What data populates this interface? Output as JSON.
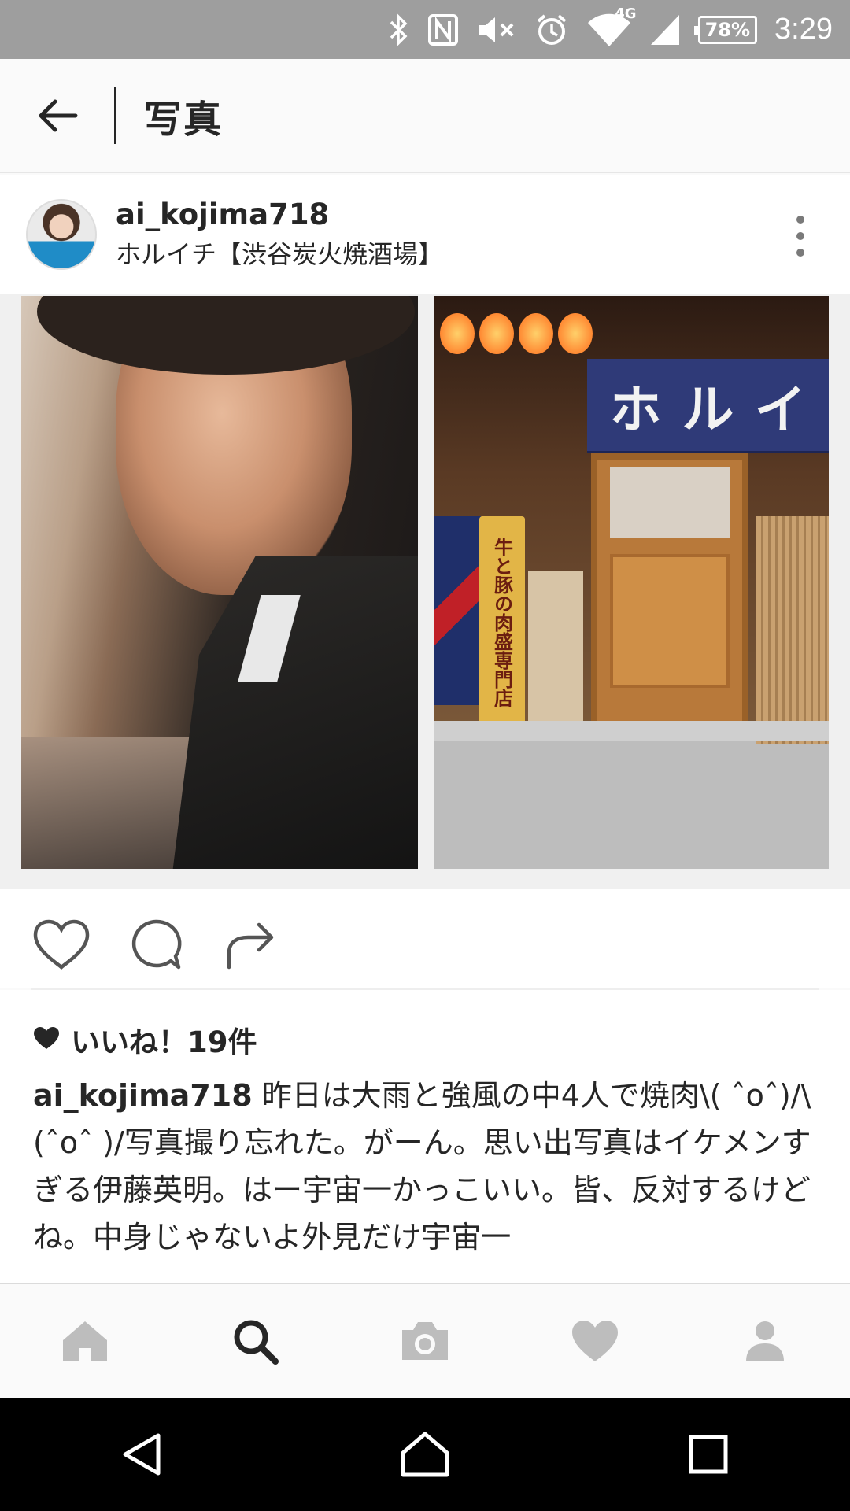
{
  "status_bar": {
    "network": "4G",
    "battery": "78%",
    "time": "3:29"
  },
  "titlebar": {
    "title": "写真"
  },
  "post": {
    "username": "ai_kojima718",
    "location": "ホルイチ【渋谷炭火焼酒場】"
  },
  "shop_sign": {
    "noren": [
      "ホ",
      "ル",
      "イ"
    ],
    "banner": "牛と豚の肉盛専門店"
  },
  "engagement": {
    "likes": "いいね！19件"
  },
  "caption": {
    "user": "ai_kojima718",
    "text": "昨日は大雨と強風の中4人で焼肉\\( ˆoˆ)/\\(ˆoˆ )/写真撮り忘れた。がーん。思い出写真はイケメンすぎる伊藤英明。はー宇宙一かっこいい。皆、反対するけどね。中身じゃないよ外見だけ宇宙一"
  },
  "colors": {
    "status_bar": "#9e9e9e",
    "text": "#262626",
    "inactive_icon": "#bdbdbd",
    "noren": "#2f3a78"
  },
  "icons": {
    "status": [
      "bluetooth-icon",
      "nfc-icon",
      "mute-icon",
      "alarm-icon",
      "wifi-icon",
      "signal-icon",
      "battery-icon"
    ],
    "actions": [
      "heart-icon",
      "comment-icon",
      "share-icon"
    ],
    "nav": [
      "home-icon",
      "search-icon",
      "camera-icon",
      "activity-heart-icon",
      "profile-icon"
    ],
    "android": [
      "back-triangle-icon",
      "home-circle-icon",
      "recents-square-icon"
    ]
  }
}
